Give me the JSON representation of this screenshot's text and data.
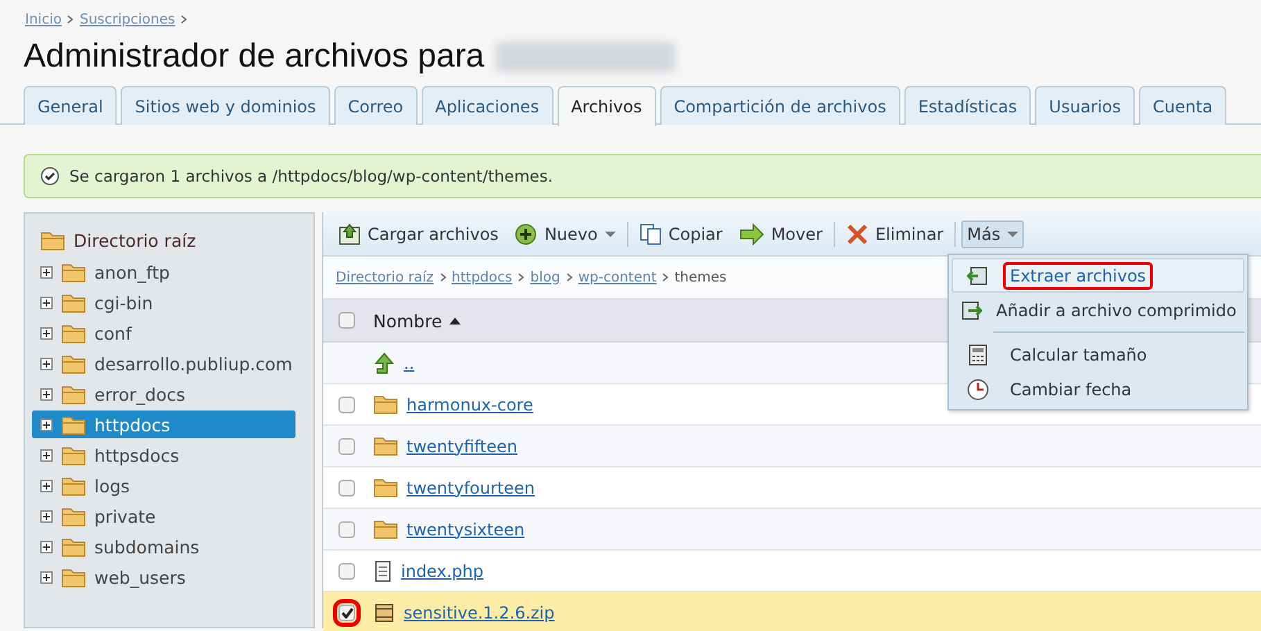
{
  "breadcrumb": [
    "Inicio",
    "Suscripciones"
  ],
  "title": "Administrador de archivos para",
  "tabs": [
    {
      "label": "General",
      "selected": false
    },
    {
      "label": "Sitios web y dominios",
      "selected": false
    },
    {
      "label": "Correo",
      "selected": false
    },
    {
      "label": "Aplicaciones",
      "selected": false
    },
    {
      "label": "Archivos",
      "selected": true
    },
    {
      "label": "Compartición de archivos",
      "selected": false
    },
    {
      "label": "Estadísticas",
      "selected": false
    },
    {
      "label": "Usuarios",
      "selected": false
    },
    {
      "label": "Cuenta",
      "selected": false
    }
  ],
  "message": "Se cargaron 1 archivos a /httpdocs/blog/wp-content/themes.",
  "tree": {
    "root": "Directorio raíz",
    "items": [
      {
        "label": "anon_ftp",
        "selected": false
      },
      {
        "label": "cgi-bin",
        "selected": false
      },
      {
        "label": "conf",
        "selected": false
      },
      {
        "label": "desarrollo.publiup.com",
        "selected": false
      },
      {
        "label": "error_docs",
        "selected": false
      },
      {
        "label": "httpdocs",
        "selected": true
      },
      {
        "label": "httpsdocs",
        "selected": false
      },
      {
        "label": "logs",
        "selected": false
      },
      {
        "label": "private",
        "selected": false
      },
      {
        "label": "subdomains",
        "selected": false
      },
      {
        "label": "web_users",
        "selected": false
      }
    ]
  },
  "toolbar": [
    {
      "kind": "upload",
      "label": "Cargar archivos",
      "caret": false,
      "pressed": false
    },
    {
      "kind": "new",
      "label": "Nuevo",
      "caret": true,
      "pressed": false
    },
    {
      "kind": "copy",
      "label": "Copiar",
      "caret": false,
      "pressed": false
    },
    {
      "kind": "move",
      "label": "Mover",
      "caret": false,
      "pressed": false
    },
    {
      "kind": "delete",
      "label": "Eliminar",
      "caret": false,
      "pressed": false
    },
    {
      "kind": "more",
      "label": "Más",
      "caret": true,
      "pressed": true
    }
  ],
  "path": {
    "links": [
      "Directorio raíz",
      "httpdocs",
      "blog",
      "wp-content"
    ],
    "current": "themes"
  },
  "table": {
    "column": "Nombre",
    "select_all_checked": false,
    "rows": [
      {
        "kind": "up",
        "name": ".."
      },
      {
        "kind": "folder",
        "name": "harmonux-core",
        "checked": false,
        "highlighted": false
      },
      {
        "kind": "folder",
        "name": "twentyfifteen",
        "checked": false,
        "highlighted": false
      },
      {
        "kind": "folder",
        "name": "twentyfourteen",
        "checked": false,
        "highlighted": false
      },
      {
        "kind": "folder",
        "name": "twentysixteen",
        "checked": false,
        "highlighted": false
      },
      {
        "kind": "file",
        "name": "index.php",
        "checked": false,
        "highlighted": false
      },
      {
        "kind": "archive",
        "name": "sensitive.1.2.6.zip",
        "checked": true,
        "highlighted": true
      }
    ]
  },
  "menu": {
    "groups": [
      [
        {
          "kind": "extract",
          "label": "Extraer archivos",
          "selected": true,
          "highlighted": true
        },
        {
          "kind": "compress",
          "label": "Añadir a archivo comprimido",
          "selected": false,
          "highlighted": false
        }
      ],
      [
        {
          "kind": "calc",
          "label": "Calcular tamaño",
          "selected": false,
          "highlighted": false
        },
        {
          "kind": "clock",
          "label": "Cambiar fecha",
          "selected": false,
          "highlighted": false
        }
      ]
    ]
  }
}
